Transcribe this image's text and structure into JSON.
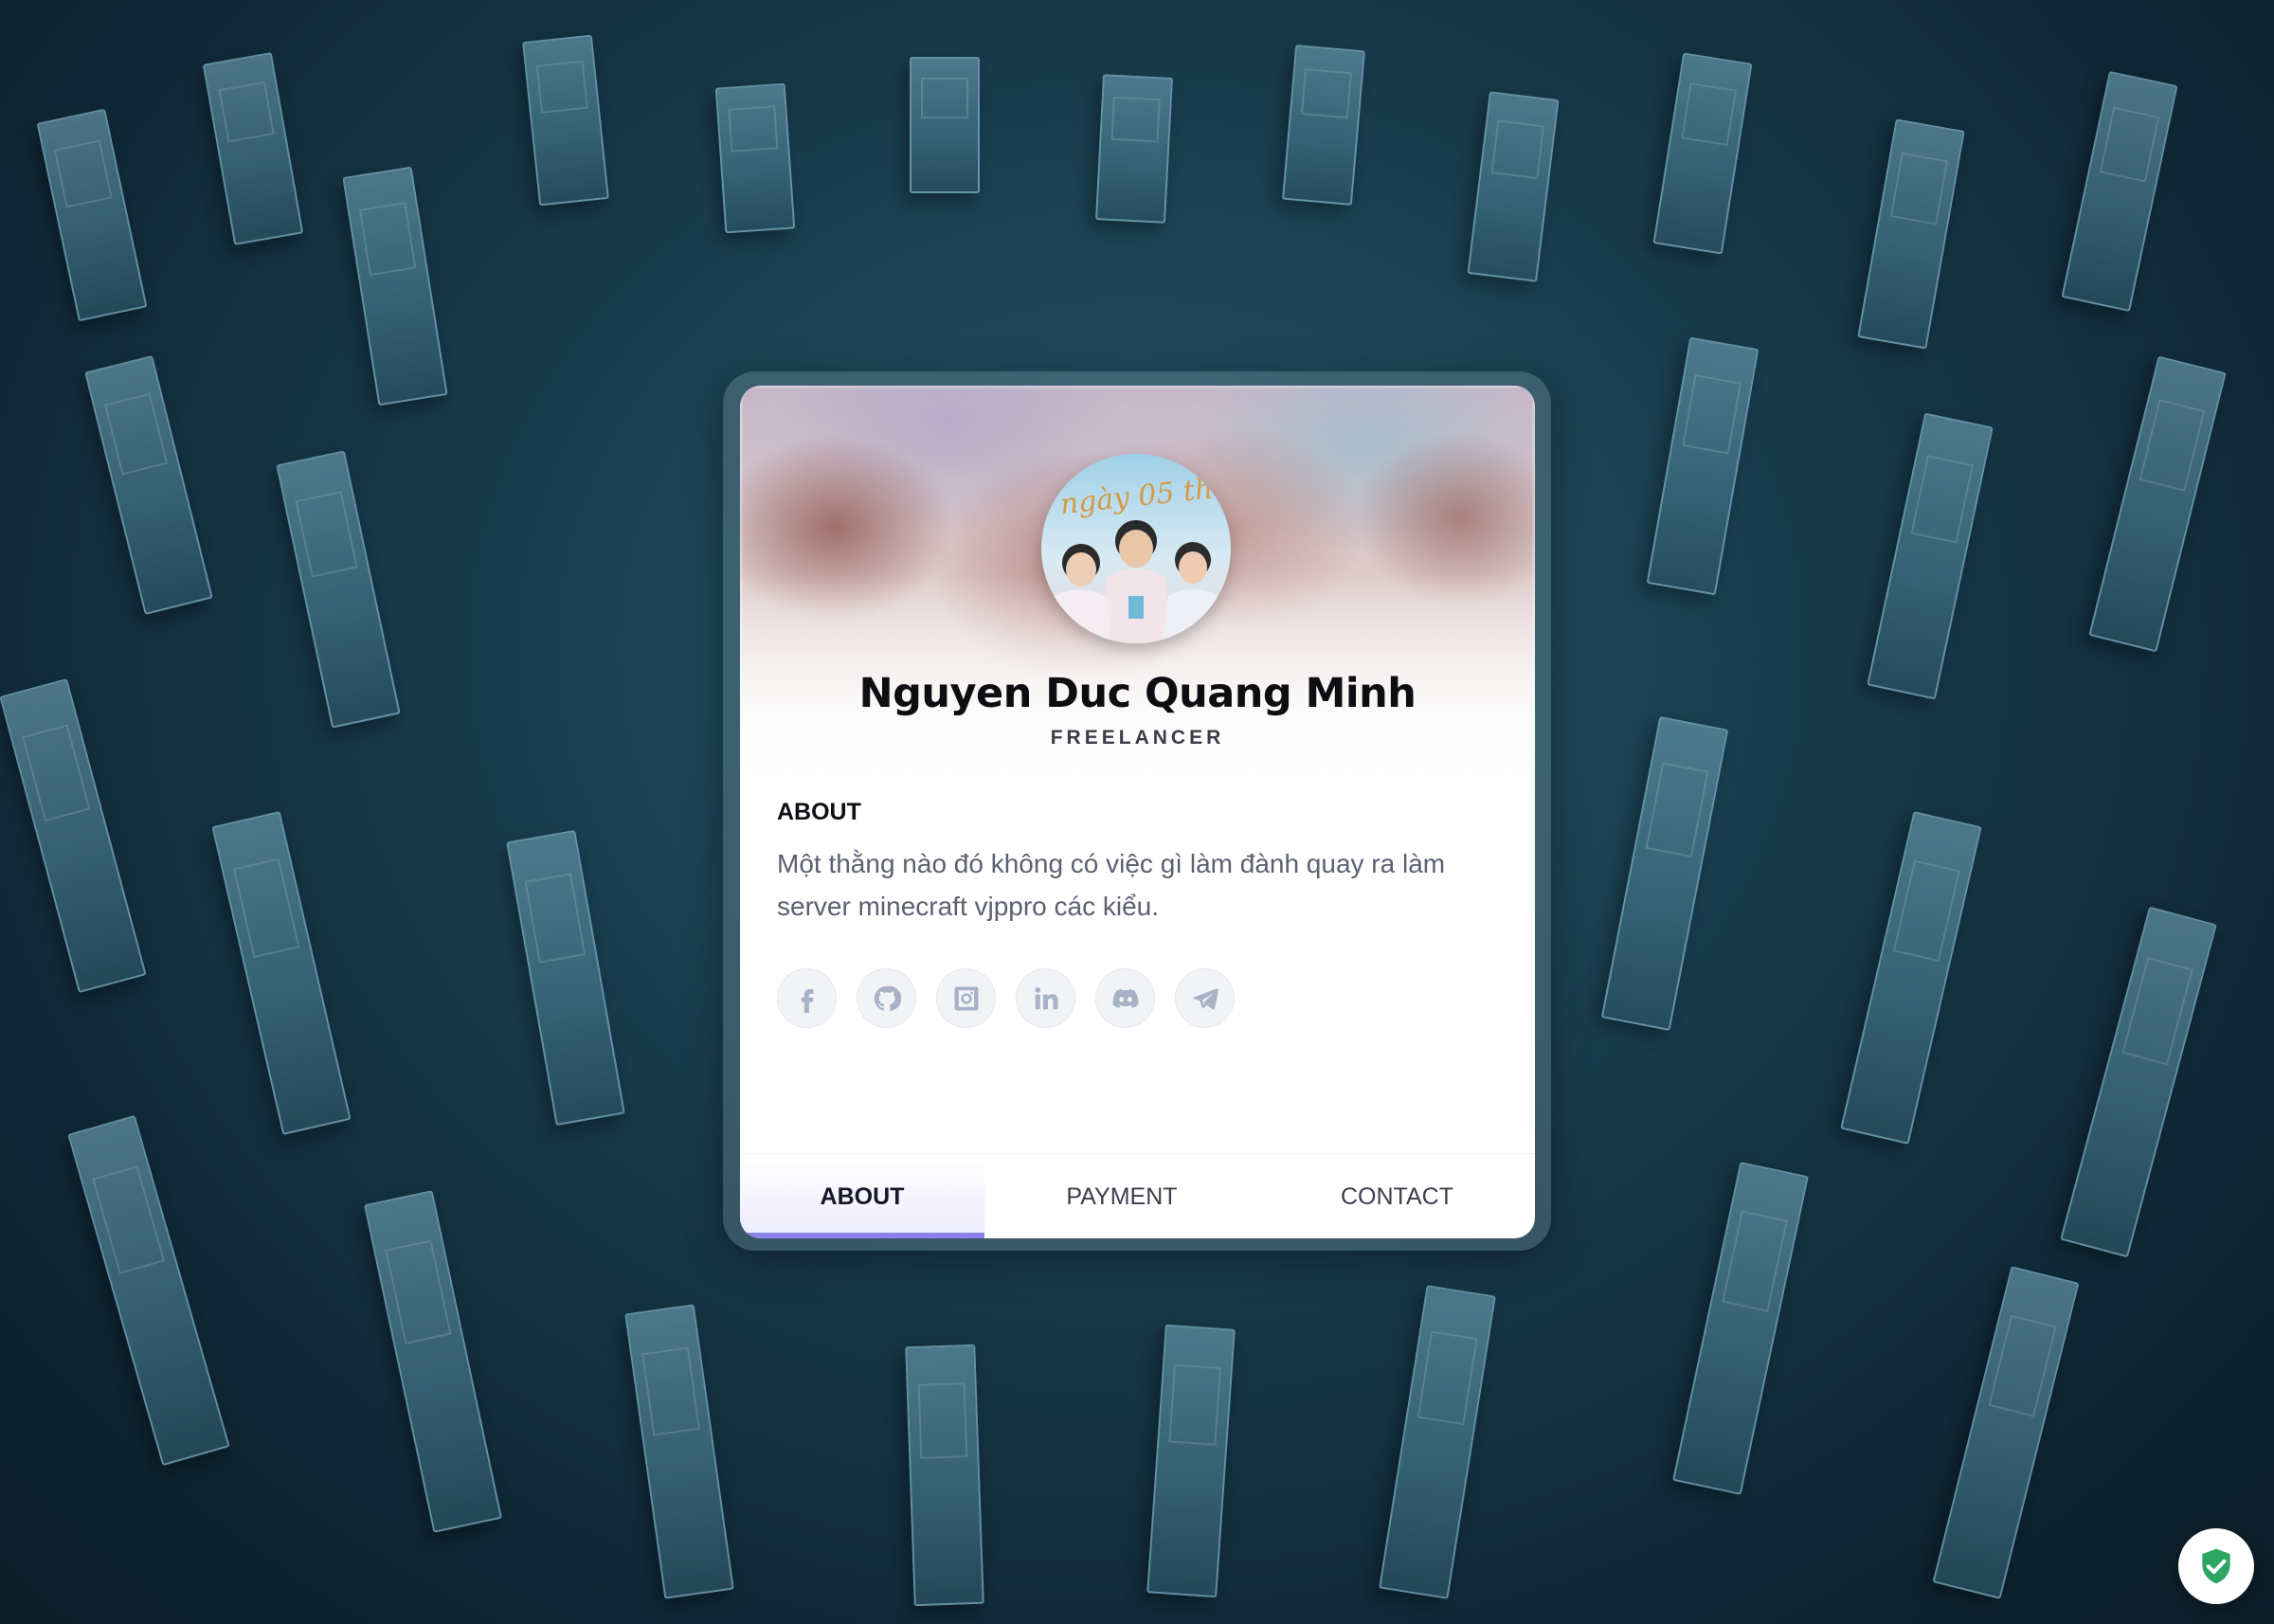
{
  "profile": {
    "name": "Nguyen Duc Quang Minh",
    "role": "FREELANCER",
    "avatar_caption": "ngày 05 th"
  },
  "about": {
    "title": "ABOUT",
    "text": "Một thằng nào đó không có việc gì làm đành quay ra làm server minecraft vjppro các kiểu."
  },
  "socials": [
    {
      "icon": "facebook-icon"
    },
    {
      "icon": "github-icon"
    },
    {
      "icon": "instagram-icon"
    },
    {
      "icon": "linkedin-icon"
    },
    {
      "icon": "discord-icon"
    },
    {
      "icon": "telegram-icon"
    }
  ],
  "tabs": {
    "about": "ABOUT",
    "payment": "PAYMENT",
    "contact": "CONTACT",
    "active": "about"
  },
  "colors": {
    "accent": "#8c82ec",
    "shield": "#2fa564"
  }
}
